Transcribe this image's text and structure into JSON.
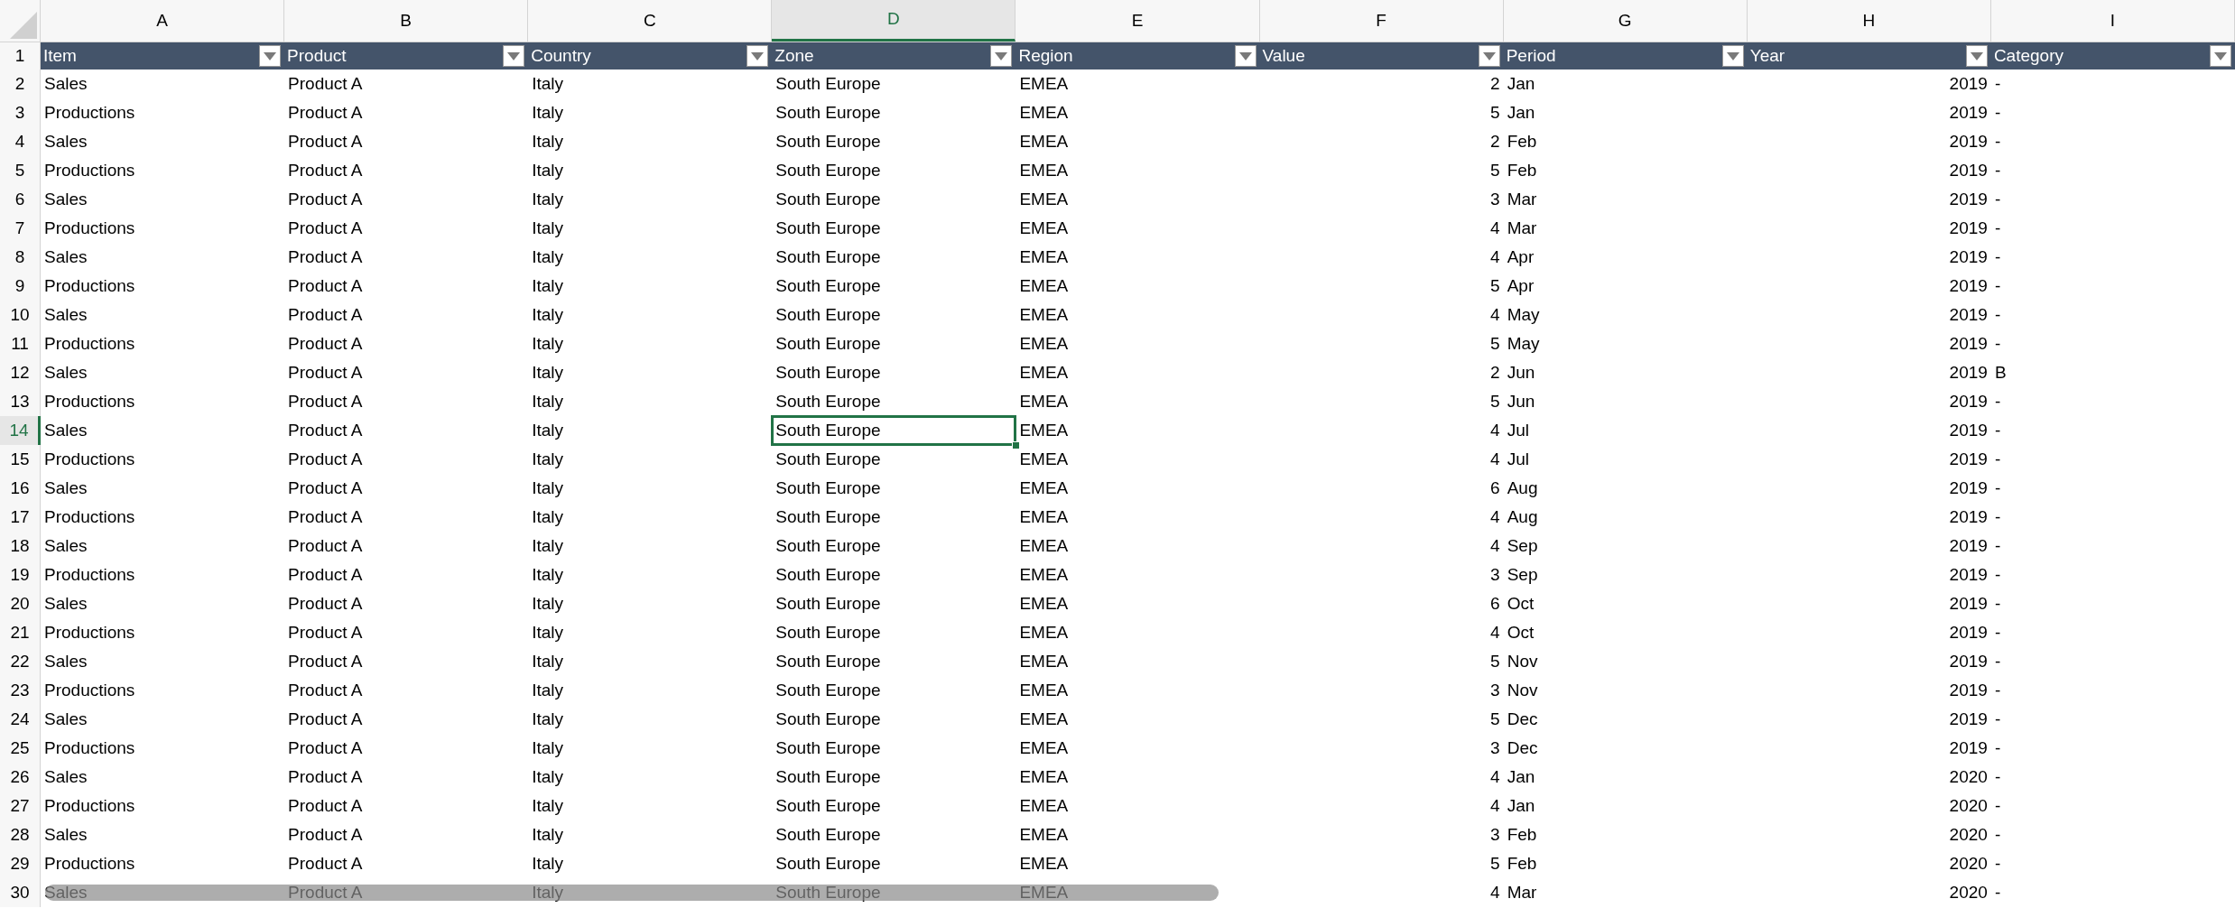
{
  "columns": [
    {
      "letter": "A",
      "selected": false
    },
    {
      "letter": "B",
      "selected": false
    },
    {
      "letter": "C",
      "selected": false
    },
    {
      "letter": "D",
      "selected": true
    },
    {
      "letter": "E",
      "selected": false
    },
    {
      "letter": "F",
      "selected": false
    },
    {
      "letter": "G",
      "selected": false
    },
    {
      "letter": "H",
      "selected": false
    },
    {
      "letter": "I",
      "selected": false
    }
  ],
  "header_row": {
    "number": "1",
    "labels": [
      "Item",
      "Product",
      "Country",
      "Zone",
      "Region",
      "Value",
      "Period",
      "Year",
      "Category"
    ]
  },
  "rows": [
    {
      "number": "2",
      "selected": false,
      "cells": [
        "Sales",
        "Product A",
        "Italy",
        "South Europe",
        "EMEA",
        "2",
        "Jan",
        "2019",
        "-"
      ]
    },
    {
      "number": "3",
      "selected": false,
      "cells": [
        "Productions",
        "Product A",
        "Italy",
        "South Europe",
        "EMEA",
        "5",
        "Jan",
        "2019",
        "-"
      ]
    },
    {
      "number": "4",
      "selected": false,
      "cells": [
        "Sales",
        "Product A",
        "Italy",
        "South Europe",
        "EMEA",
        "2",
        "Feb",
        "2019",
        "-"
      ]
    },
    {
      "number": "5",
      "selected": false,
      "cells": [
        "Productions",
        "Product A",
        "Italy",
        "South Europe",
        "EMEA",
        "5",
        "Feb",
        "2019",
        "-"
      ]
    },
    {
      "number": "6",
      "selected": false,
      "cells": [
        "Sales",
        "Product A",
        "Italy",
        "South Europe",
        "EMEA",
        "3",
        "Mar",
        "2019",
        "-"
      ]
    },
    {
      "number": "7",
      "selected": false,
      "cells": [
        "Productions",
        "Product A",
        "Italy",
        "South Europe",
        "EMEA",
        "4",
        "Mar",
        "2019",
        "-"
      ]
    },
    {
      "number": "8",
      "selected": false,
      "cells": [
        "Sales",
        "Product A",
        "Italy",
        "South Europe",
        "EMEA",
        "4",
        "Apr",
        "2019",
        "-"
      ]
    },
    {
      "number": "9",
      "selected": false,
      "cells": [
        "Productions",
        "Product A",
        "Italy",
        "South Europe",
        "EMEA",
        "5",
        "Apr",
        "2019",
        "-"
      ]
    },
    {
      "number": "10",
      "selected": false,
      "cells": [
        "Sales",
        "Product A",
        "Italy",
        "South Europe",
        "EMEA",
        "4",
        "May",
        "2019",
        "-"
      ]
    },
    {
      "number": "11",
      "selected": false,
      "cells": [
        "Productions",
        "Product A",
        "Italy",
        "South Europe",
        "EMEA",
        "5",
        "May",
        "2019",
        "-"
      ]
    },
    {
      "number": "12",
      "selected": false,
      "cells": [
        "Sales",
        "Product A",
        "Italy",
        "South Europe",
        "EMEA",
        "2",
        "Jun",
        "2019",
        "B"
      ]
    },
    {
      "number": "13",
      "selected": false,
      "cells": [
        "Productions",
        "Product A",
        "Italy",
        "South Europe",
        "EMEA",
        "5",
        "Jun",
        "2019",
        "-"
      ]
    },
    {
      "number": "14",
      "selected": true,
      "cells": [
        "Sales",
        "Product A",
        "Italy",
        "South Europe",
        "EMEA",
        "4",
        "Jul",
        "2019",
        "-"
      ]
    },
    {
      "number": "15",
      "selected": false,
      "cells": [
        "Productions",
        "Product A",
        "Italy",
        "South Europe",
        "EMEA",
        "4",
        "Jul",
        "2019",
        "-"
      ]
    },
    {
      "number": "16",
      "selected": false,
      "cells": [
        "Sales",
        "Product A",
        "Italy",
        "South Europe",
        "EMEA",
        "6",
        "Aug",
        "2019",
        "-"
      ]
    },
    {
      "number": "17",
      "selected": false,
      "cells": [
        "Productions",
        "Product A",
        "Italy",
        "South Europe",
        "EMEA",
        "4",
        "Aug",
        "2019",
        "-"
      ]
    },
    {
      "number": "18",
      "selected": false,
      "cells": [
        "Sales",
        "Product A",
        "Italy",
        "South Europe",
        "EMEA",
        "4",
        "Sep",
        "2019",
        "-"
      ]
    },
    {
      "number": "19",
      "selected": false,
      "cells": [
        "Productions",
        "Product A",
        "Italy",
        "South Europe",
        "EMEA",
        "3",
        "Sep",
        "2019",
        "-"
      ]
    },
    {
      "number": "20",
      "selected": false,
      "cells": [
        "Sales",
        "Product A",
        "Italy",
        "South Europe",
        "EMEA",
        "6",
        "Oct",
        "2019",
        "-"
      ]
    },
    {
      "number": "21",
      "selected": false,
      "cells": [
        "Productions",
        "Product A",
        "Italy",
        "South Europe",
        "EMEA",
        "4",
        "Oct",
        "2019",
        "-"
      ]
    },
    {
      "number": "22",
      "selected": false,
      "cells": [
        "Sales",
        "Product A",
        "Italy",
        "South Europe",
        "EMEA",
        "5",
        "Nov",
        "2019",
        "-"
      ]
    },
    {
      "number": "23",
      "selected": false,
      "cells": [
        "Productions",
        "Product A",
        "Italy",
        "South Europe",
        "EMEA",
        "3",
        "Nov",
        "2019",
        "-"
      ]
    },
    {
      "number": "24",
      "selected": false,
      "cells": [
        "Sales",
        "Product A",
        "Italy",
        "South Europe",
        "EMEA",
        "5",
        "Dec",
        "2019",
        "-"
      ]
    },
    {
      "number": "25",
      "selected": false,
      "cells": [
        "Productions",
        "Product A",
        "Italy",
        "South Europe",
        "EMEA",
        "3",
        "Dec",
        "2019",
        "-"
      ]
    },
    {
      "number": "26",
      "selected": false,
      "cells": [
        "Sales",
        "Product A",
        "Italy",
        "South Europe",
        "EMEA",
        "4",
        "Jan",
        "2020",
        "-"
      ]
    },
    {
      "number": "27",
      "selected": false,
      "cells": [
        "Productions",
        "Product A",
        "Italy",
        "South Europe",
        "EMEA",
        "4",
        "Jan",
        "2020",
        "-"
      ]
    },
    {
      "number": "28",
      "selected": false,
      "cells": [
        "Sales",
        "Product A",
        "Italy",
        "South Europe",
        "EMEA",
        "3",
        "Feb",
        "2020",
        "-"
      ]
    },
    {
      "number": "29",
      "selected": false,
      "cells": [
        "Productions",
        "Product A",
        "Italy",
        "South Europe",
        "EMEA",
        "5",
        "Feb",
        "2020",
        "-"
      ]
    },
    {
      "number": "30",
      "selected": false,
      "cells": [
        "Sales",
        "Product A",
        "Italy",
        "South Europe",
        "EMEA",
        "4",
        "Mar",
        "2020",
        "-"
      ]
    }
  ]
}
